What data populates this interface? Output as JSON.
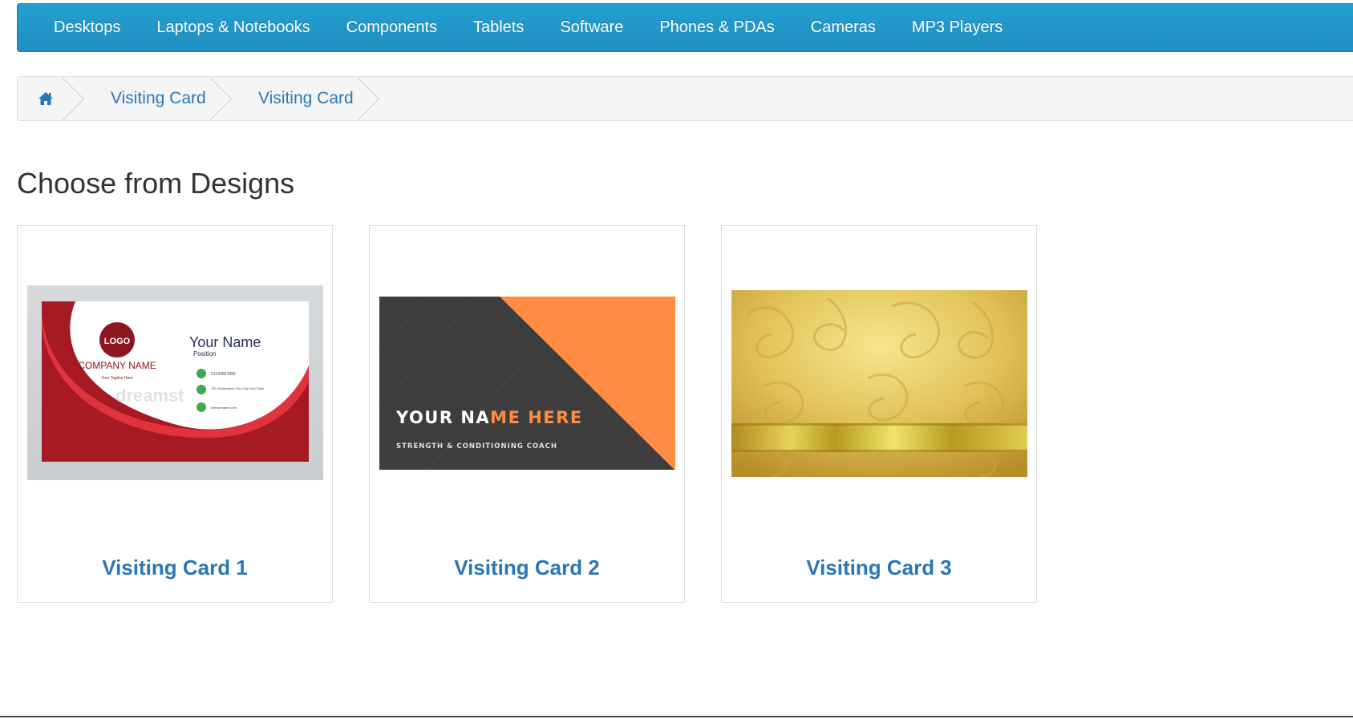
{
  "nav": {
    "items": [
      {
        "label": "Desktops"
      },
      {
        "label": "Laptops & Notebooks"
      },
      {
        "label": "Components"
      },
      {
        "label": "Tablets"
      },
      {
        "label": "Software"
      },
      {
        "label": "Phones & PDAs"
      },
      {
        "label": "Cameras"
      },
      {
        "label": "MP3 Players"
      }
    ]
  },
  "breadcrumb": {
    "home_icon": "home-icon",
    "items": [
      {
        "label": "Visiting Card"
      },
      {
        "label": "Visiting Card"
      }
    ]
  },
  "main": {
    "title": "Choose from Designs",
    "products": [
      {
        "title": "Visiting Card 1",
        "image": {
          "logo_text": "LOGO",
          "company": "COMPANY NAME",
          "tagline": "Your Tagline Here",
          "name": "Your Name",
          "position": "Position",
          "phone": "01234567890",
          "address": "100, Addressline,Your City Your State",
          "website": "websitename.com",
          "watermark": "dreamst"
        }
      },
      {
        "title": "Visiting Card 2",
        "image": {
          "name_white": "YOUR NA",
          "name_orange": "ME HERE",
          "subtitle": "STRENGTH & CONDITIONING COACH"
        }
      },
      {
        "title": "Visiting Card 3",
        "image": {}
      }
    ]
  },
  "colors": {
    "nav_bg": "#229acf",
    "link": "#2a77b8",
    "card1_red": "#a01c24",
    "card2_dark": "#3d3d3d",
    "card2_orange": "#ff8c42",
    "gold": "#d4b445"
  }
}
